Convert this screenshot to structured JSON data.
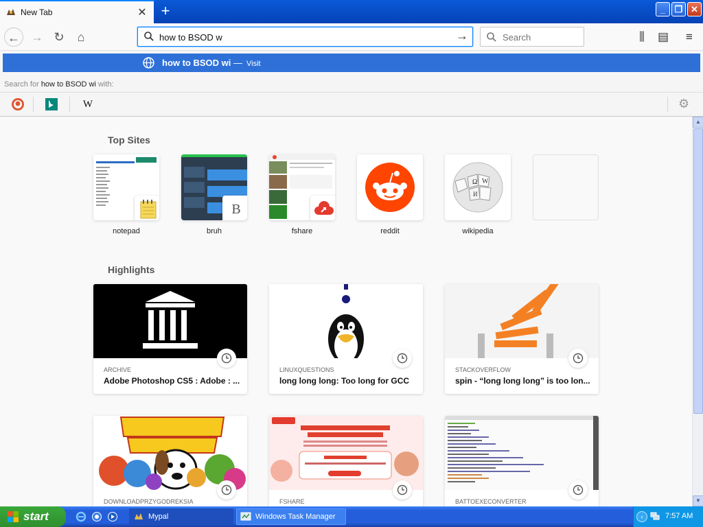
{
  "tab": {
    "title": "New Tab",
    "close_glyph": "✕",
    "new_tab_glyph": "+"
  },
  "window_controls": {
    "minimize": "_",
    "maximize": "❐",
    "close": "✕"
  },
  "toolbar": {
    "back_glyph": "←",
    "forward_glyph": "→",
    "reload_glyph": "↻",
    "home_glyph": "⌂",
    "url_value": "how to BSOD w",
    "go_glyph": "→",
    "search_placeholder": "Search",
    "library_glyph": "⫼",
    "sidebar_glyph": "▤",
    "menu_glyph": "≡"
  },
  "popup": {
    "suggestion_text": "how to BSOD wi",
    "suggestion_dash": "—",
    "suggestion_action": "Visit",
    "search_for_prefix": "Search for",
    "search_for_query": "how to BSOD wi",
    "search_for_suffix": "with:",
    "engines": [
      "duckduckgo-icon",
      "bing-icon",
      "wikipedia-icon"
    ],
    "wiki_glyph": "W",
    "settings_glyph": "⚙"
  },
  "top_sites": {
    "title": "Top Sites",
    "items": [
      {
        "label": "notepad"
      },
      {
        "label": "bruh",
        "badge": "B"
      },
      {
        "label": "fshare"
      },
      {
        "label": "reddit"
      },
      {
        "label": "wikipedia"
      },
      {
        "label": ""
      }
    ]
  },
  "highlights": {
    "title": "Highlights",
    "items": [
      {
        "source": "ARCHIVE",
        "title": "Adobe Photoshop CS5 : Adobe : ..."
      },
      {
        "source": "LINUXQUESTIONS",
        "title": "long long long: Too long for GCC"
      },
      {
        "source": "STACKOVERFLOW",
        "title": "spin - “long long long” is too lon..."
      },
      {
        "source": "DOWNLOADPRZYGODREKSIA",
        "title": ""
      },
      {
        "source": "FSHARE",
        "title": ""
      },
      {
        "source": "BATTOEXECONVERTER",
        "title": ""
      }
    ]
  },
  "taskbar": {
    "start_label": "start",
    "tasks": [
      {
        "label": "Mypal"
      },
      {
        "label": "Windows Task Manager"
      }
    ],
    "clock": "7:57 AM",
    "tray_arrow": "‹"
  },
  "scrollbar": {
    "up_glyph": "▲",
    "down_glyph": "▼"
  },
  "colors": {
    "accent": "#0a84ff",
    "suggestion_bg": "#2e70d8",
    "taskbar": "#245edb",
    "start": "#3aa83a"
  }
}
